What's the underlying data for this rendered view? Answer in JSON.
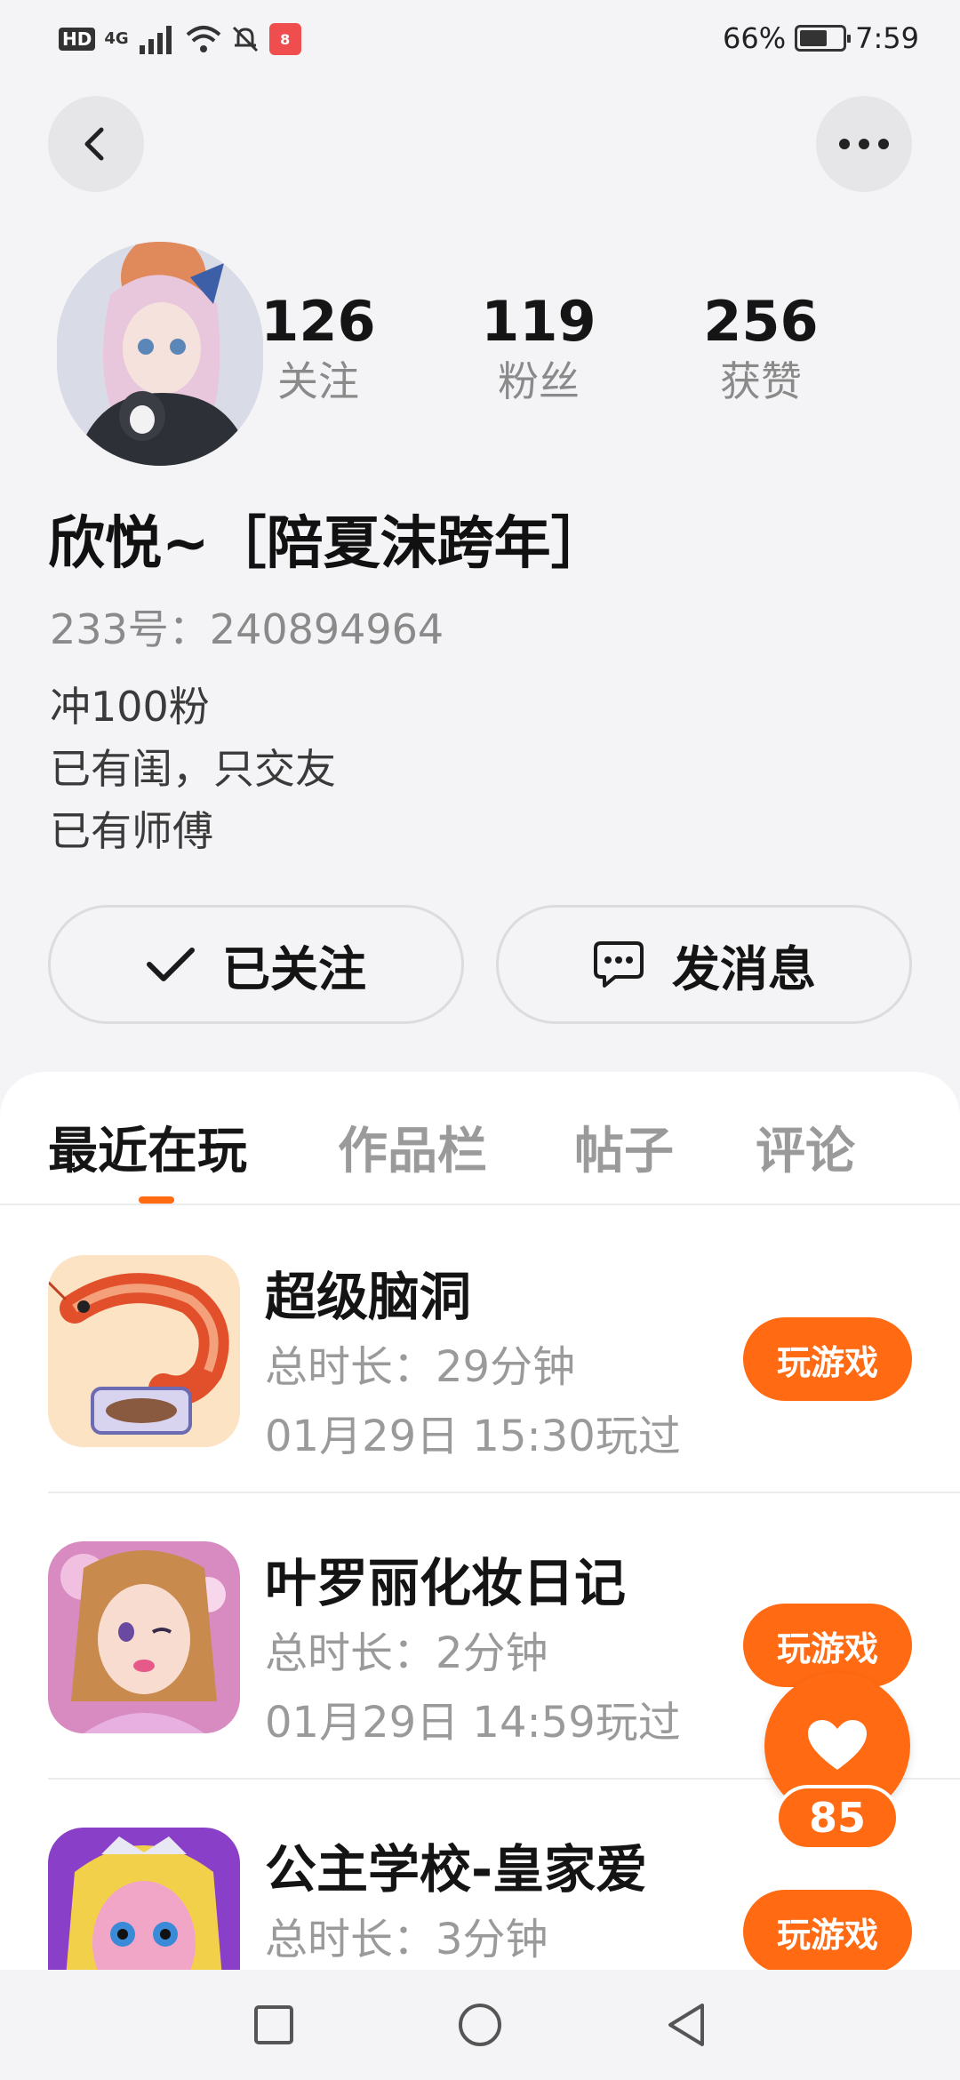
{
  "status_bar": {
    "hd": "HD",
    "network": "4G",
    "app_badge": "8",
    "battery_percent": "66%",
    "battery_level": 0.66,
    "time": "7:59"
  },
  "header": {
    "back_icon": "chevron-left-icon",
    "more_icon": "more-horizontal-icon"
  },
  "profile": {
    "stats": [
      {
        "value": "126",
        "label": "关注"
      },
      {
        "value": "119",
        "label": "粉丝"
      },
      {
        "value": "256",
        "label": "获赞"
      }
    ],
    "nickname": "欣悦~［陪夏沫跨年］",
    "user_id": "233号：240894964",
    "bio": [
      "冲100粉",
      "已有闺，只交友",
      "已有师傅"
    ]
  },
  "actions": {
    "follow_label": "已关注",
    "message_label": "发消息"
  },
  "tabs": [
    {
      "label": "最近在玩",
      "active": true
    },
    {
      "label": "作品栏",
      "active": false
    },
    {
      "label": "帖子",
      "active": false
    },
    {
      "label": "评论",
      "active": false
    }
  ],
  "games": [
    {
      "title": "超级脑洞",
      "duration": "总时长：29分钟",
      "last_played": "01月29日 15:30玩过",
      "button": "玩游戏"
    },
    {
      "title": "叶罗丽化妆日记",
      "duration": "总时长：2分钟",
      "last_played": "01月29日 14:59玩过",
      "button": "玩游戏"
    },
    {
      "title": "公主学校-皇家爱",
      "duration": "总时长：3分钟",
      "last_played": "",
      "button": "玩游戏"
    }
  ],
  "like_float": {
    "count": "85",
    "icon": "heart-icon"
  },
  "colors": {
    "accent": "#ff6a13",
    "background": "#f4f4f6"
  }
}
